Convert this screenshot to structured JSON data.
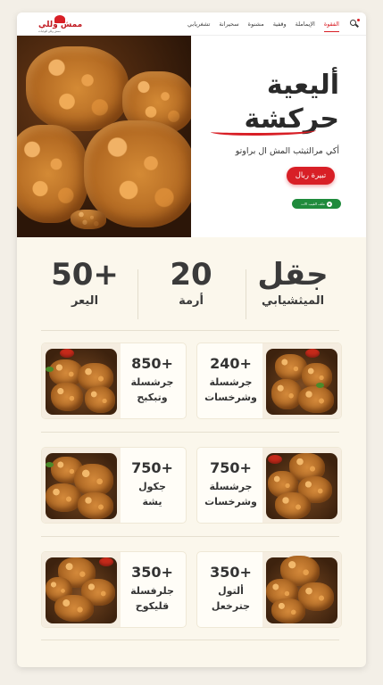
{
  "header": {
    "logo_text": "ممش وللي",
    "logo_sub": "ممش وللي للوجبات",
    "nav": [
      {
        "label": "الفقوة",
        "active": true
      },
      {
        "label": "الإيماملة",
        "active": false
      },
      {
        "label": "وقفية",
        "active": false
      },
      {
        "label": "مشنوة",
        "active": false
      },
      {
        "label": "سحيرانة",
        "active": false
      },
      {
        "label": "تشغريابي",
        "active": false
      }
    ]
  },
  "hero": {
    "title_line1": "أليعية",
    "title_line2": "حركشة",
    "subtitle": "أكي مرالثيثب المش ال براوتو",
    "cta_label": "تبيرة ربال",
    "whatsapp_label": "ملف القيب الات"
  },
  "stats": [
    {
      "value": "جقل",
      "label": "الميثشيابي"
    },
    {
      "value": "20",
      "label": "أرمة"
    },
    {
      "value": "50+",
      "label": "اليعر"
    }
  ],
  "products": [
    {
      "value": "240+",
      "line1": "جرشسلة",
      "line2": "وشرخسات"
    },
    {
      "value": "850+",
      "line1": "جرشسلة",
      "line2": "وتبكبح"
    },
    {
      "value": "750+",
      "line1": "جرشسلة",
      "line2": "وشرخسات"
    },
    {
      "value": "750+",
      "line1": "جكول",
      "line2": "يشة"
    },
    {
      "value": "350+",
      "line1": "ألتول",
      "line2": "جترخعل"
    },
    {
      "value": "350+",
      "line1": "جلرفسلة",
      "line2": "قليكوح"
    }
  ],
  "colors": {
    "accent": "#d81f26",
    "whatsapp": "#1f8b3c",
    "background": "#fbf7ec"
  },
  "icons": [
    "search-icon",
    "whatsapp-icon",
    "logo-mark"
  ]
}
